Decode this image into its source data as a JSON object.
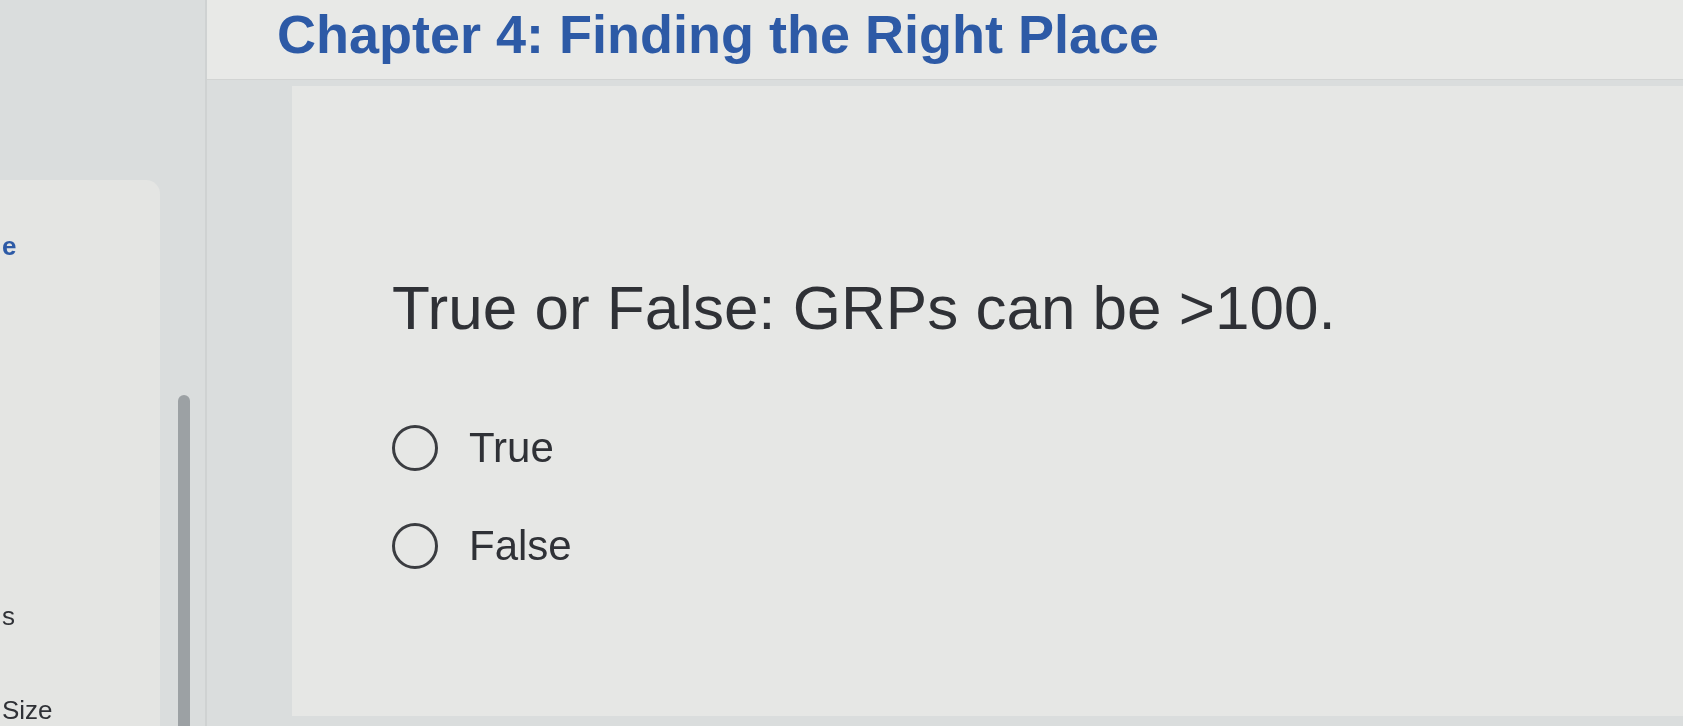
{
  "header": {
    "title": "Chapter 4: Finding the Right Place"
  },
  "sidebar": {
    "items": [
      {
        "label": "e",
        "kind": "link"
      },
      {
        "label": "s",
        "kind": "text"
      },
      {
        "label": "Size",
        "kind": "text"
      }
    ]
  },
  "question": {
    "text": "True or False: GRPs can be >100.",
    "options": [
      {
        "label": "True",
        "selected": false
      },
      {
        "label": "False",
        "selected": false
      }
    ]
  }
}
